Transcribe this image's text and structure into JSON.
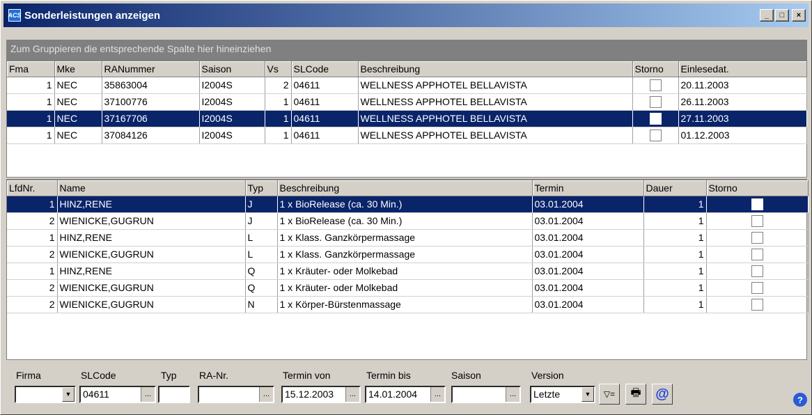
{
  "window": {
    "title": "Sonderleistungen anzeigen",
    "icon_text": "ACS",
    "buttons": {
      "minimize": "_",
      "maximize": "□",
      "close": "×"
    }
  },
  "group_panel": {
    "text": "Zum Gruppieren die entsprechende Spalte hier hineinziehen"
  },
  "grid_top": {
    "columns": [
      "Fma",
      "Mke",
      "RANummer",
      "Saison",
      "Vs",
      "SLCode",
      "Beschreibung",
      "Storno",
      "Einlesedat."
    ],
    "rows": [
      {
        "fma": "1",
        "mke": "NEC",
        "ranummer": "35863004",
        "saison": "I2004S",
        "vs": "2",
        "slcode": "04611",
        "beschreibung": "WELLNESS APPHOTEL BELLAVISTA",
        "storno": false,
        "einlesedat": "20.11.2003",
        "selected": false
      },
      {
        "fma": "1",
        "mke": "NEC",
        "ranummer": "37100776",
        "saison": "I2004S",
        "vs": "1",
        "slcode": "04611",
        "beschreibung": "WELLNESS APPHOTEL BELLAVISTA",
        "storno": false,
        "einlesedat": "26.11.2003",
        "selected": false
      },
      {
        "fma": "1",
        "mke": "NEC",
        "ranummer": "37167706",
        "saison": "I2004S",
        "vs": "1",
        "slcode": "04611",
        "beschreibung": "WELLNESS APPHOTEL BELLAVISTA",
        "storno": false,
        "einlesedat": "27.11.2003",
        "selected": true
      },
      {
        "fma": "1",
        "mke": "NEC",
        "ranummer": "37084126",
        "saison": "I2004S",
        "vs": "1",
        "slcode": "04611",
        "beschreibung": "WELLNESS APPHOTEL BELLAVISTA",
        "storno": false,
        "einlesedat": "01.12.2003",
        "selected": false
      }
    ]
  },
  "grid_bottom": {
    "columns": [
      "LfdNr.",
      "Name",
      "Typ",
      "Beschreibung",
      "Termin",
      "Dauer",
      "Storno"
    ],
    "rows": [
      {
        "lfdnr": "1",
        "name": "HINZ,RENE",
        "typ": "J",
        "beschreibung": "1 x BioRelease (ca. 30 Min.)",
        "termin": "03.01.2004",
        "dauer": "1",
        "storno": false,
        "selected": true
      },
      {
        "lfdnr": "2",
        "name": "WIENICKE,GUGRUN",
        "typ": "J",
        "beschreibung": "1 x BioRelease (ca. 30 Min.)",
        "termin": "03.01.2004",
        "dauer": "1",
        "storno": false,
        "selected": false
      },
      {
        "lfdnr": "1",
        "name": "HINZ,RENE",
        "typ": "L",
        "beschreibung": "1 x Klass. Ganzkörpermassage",
        "termin": "03.01.2004",
        "dauer": "1",
        "storno": false,
        "selected": false
      },
      {
        "lfdnr": "2",
        "name": "WIENICKE,GUGRUN",
        "typ": "L",
        "beschreibung": "1 x Klass. Ganzkörpermassage",
        "termin": "03.01.2004",
        "dauer": "1",
        "storno": false,
        "selected": false
      },
      {
        "lfdnr": "1",
        "name": "HINZ,RENE",
        "typ": "Q",
        "beschreibung": "1 x Kräuter- oder Molkebad",
        "termin": "03.01.2004",
        "dauer": "1",
        "storno": false,
        "selected": false
      },
      {
        "lfdnr": "2",
        "name": "WIENICKE,GUGRUN",
        "typ": "Q",
        "beschreibung": "1 x Kräuter- oder Molkebad",
        "termin": "03.01.2004",
        "dauer": "1",
        "storno": false,
        "selected": false
      },
      {
        "lfdnr": "2",
        "name": "WIENICKE,GUGRUN",
        "typ": "N",
        "beschreibung": "1 x Körper-Bürstenmassage",
        "termin": "03.01.2004",
        "dauer": "1",
        "storno": false,
        "selected": false
      }
    ]
  },
  "filters": {
    "firma": {
      "label": "Firma",
      "value": ""
    },
    "slcode": {
      "label": "SLCode",
      "value": "04611"
    },
    "typ": {
      "label": "Typ",
      "value": ""
    },
    "ranr": {
      "label": "RA-Nr.",
      "value": ""
    },
    "termin_von": {
      "label": "Termin von",
      "value": "15.12.2003"
    },
    "termin_bis": {
      "label": "Termin bis",
      "value": "14.01.2004"
    },
    "saison": {
      "label": "Saison",
      "value": ""
    },
    "version": {
      "label": "Version",
      "value": "Letzte"
    },
    "ellipsis": "...",
    "dropdown_arrow": "▼"
  },
  "toolbar": {
    "filter_icon": "filter-icon",
    "print_icon": "printer-icon",
    "email_icon": "email-icon",
    "filter_glyph": "▽=",
    "print_glyph": "🖶",
    "email_glyph": "@"
  },
  "help": {
    "glyph": "?"
  },
  "colors": {
    "titlebar_start": "#0a246a",
    "titlebar_end": "#a6caf0",
    "selection": "#0a246a",
    "group_panel": "#808080"
  }
}
